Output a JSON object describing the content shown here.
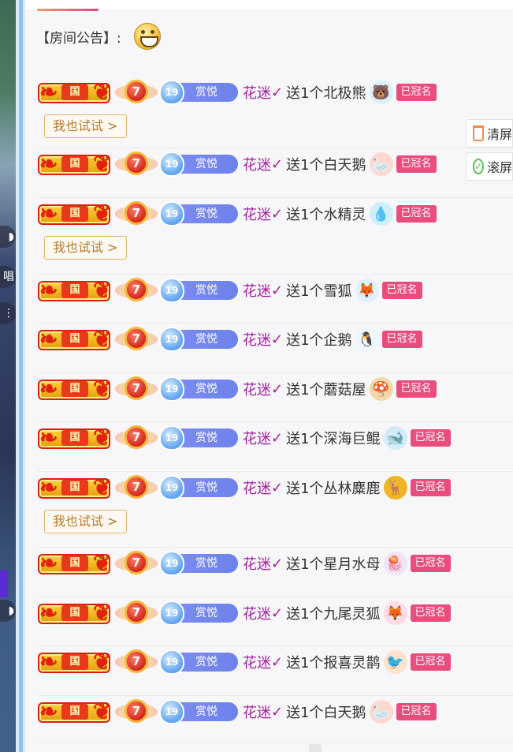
{
  "notice": {
    "label": "【房间公告】:"
  },
  "badges": {
    "guo": "国",
    "rank": "7",
    "level": "19",
    "level_text": "赏悦"
  },
  "named_label": "已冠名",
  "try_label": "我也试试 >",
  "side_tools": {
    "clear": "清屏",
    "scroll": "滚屏"
  },
  "colors": {
    "user": "#a31ea1",
    "named_badge": "#e94d7d",
    "try_border": "#e2b36a",
    "accent": "#8fc4ea"
  },
  "messages": [
    {
      "user": "花迷",
      "text": "送1个北极熊",
      "gift_icon": "polar-bear-icon",
      "try": true
    },
    {
      "user": "花迷",
      "text": "送1个白天鹅",
      "gift_icon": "swan-icon",
      "try": false
    },
    {
      "user": "花迷",
      "text": "送1个水精灵",
      "gift_icon": "water-spirit-icon",
      "try": true
    },
    {
      "user": "花迷",
      "text": "送1个雪狐",
      "gift_icon": "snow-fox-icon",
      "try": false
    },
    {
      "user": "花迷",
      "text": "送1个企鹅",
      "gift_icon": "penguin-icon",
      "try": false
    },
    {
      "user": "花迷",
      "text": "送1个蘑菇屋",
      "gift_icon": "mushroom-house-icon",
      "try": false
    },
    {
      "user": "花迷",
      "text": "送1个深海巨鲲",
      "gift_icon": "sea-whale-icon",
      "try": false
    },
    {
      "user": "花迷",
      "text": "送1个丛林麋鹿",
      "gift_icon": "jungle-deer-icon",
      "try": true
    },
    {
      "user": "花迷",
      "text": "送1个星月水母",
      "gift_icon": "jellyfish-icon",
      "try": false
    },
    {
      "user": "花迷",
      "text": "送1个九尾灵狐",
      "gift_icon": "nine-tail-fox-icon",
      "try": false
    },
    {
      "user": "花迷",
      "text": "送1个报喜灵鹊",
      "gift_icon": "magpie-icon",
      "try": false
    },
    {
      "user": "花迷",
      "text": "送1个白天鹅",
      "gift_icon": "swan-icon",
      "try": false
    }
  ]
}
